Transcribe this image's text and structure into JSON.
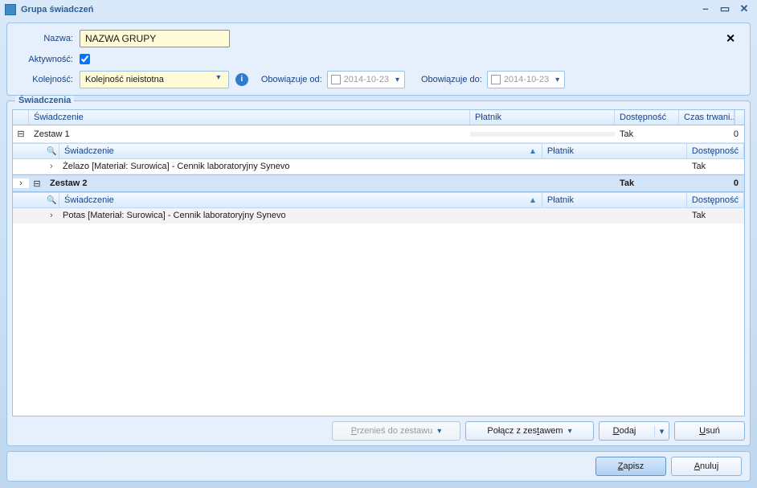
{
  "window": {
    "title": "Grupa świadczeń"
  },
  "form": {
    "nazwa_label": "Nazwa:",
    "nazwa_value": "NAZWA GRUPY",
    "aktywnosc_label": "Aktywność:",
    "aktywnosc_checked": true,
    "kolejnosc_label": "Kolejność:",
    "kolejnosc_value": "Kolejność nieistotna",
    "obow_od_label": "Obowiązuje od:",
    "obow_od_value": "2014-10-23",
    "obow_do_label": "Obowiązuje do:",
    "obow_do_value": "2014-10-23"
  },
  "fieldset_title": "Świadczenia",
  "grid": {
    "columns": {
      "swiadczenie": "Świadczenie",
      "platnik": "Płatnik",
      "dostepnosc": "Dostępność",
      "czas": "Czas trwani..."
    },
    "nested_columns": {
      "swiadczenie": "Świadczenie",
      "platnik": "Płatnik",
      "dostepnosc": "Dostępność"
    },
    "zestaw1": {
      "label": "Zestaw 1",
      "dostepnosc": "Tak",
      "czas": "0",
      "item_name": "Żelazo [Materiał: Surowica] - Cennik laboratoryjny Synevo",
      "item_dostepnosc": "Tak"
    },
    "zestaw2": {
      "label": "Zestaw 2",
      "dostepnosc": "Tak",
      "czas": "0",
      "item_name": "Potas [Materiał: Surowica] - Cennik laboratoryjny Synevo",
      "item_dostepnosc": "Tak"
    }
  },
  "buttons": {
    "przenies": "Przenieś do zestawu",
    "polacz": "Połącz z zestawem",
    "dodaj": "Dodaj",
    "usun": "Usuń",
    "zapisz": "Zapisz",
    "anuluj": "Anuluj"
  }
}
